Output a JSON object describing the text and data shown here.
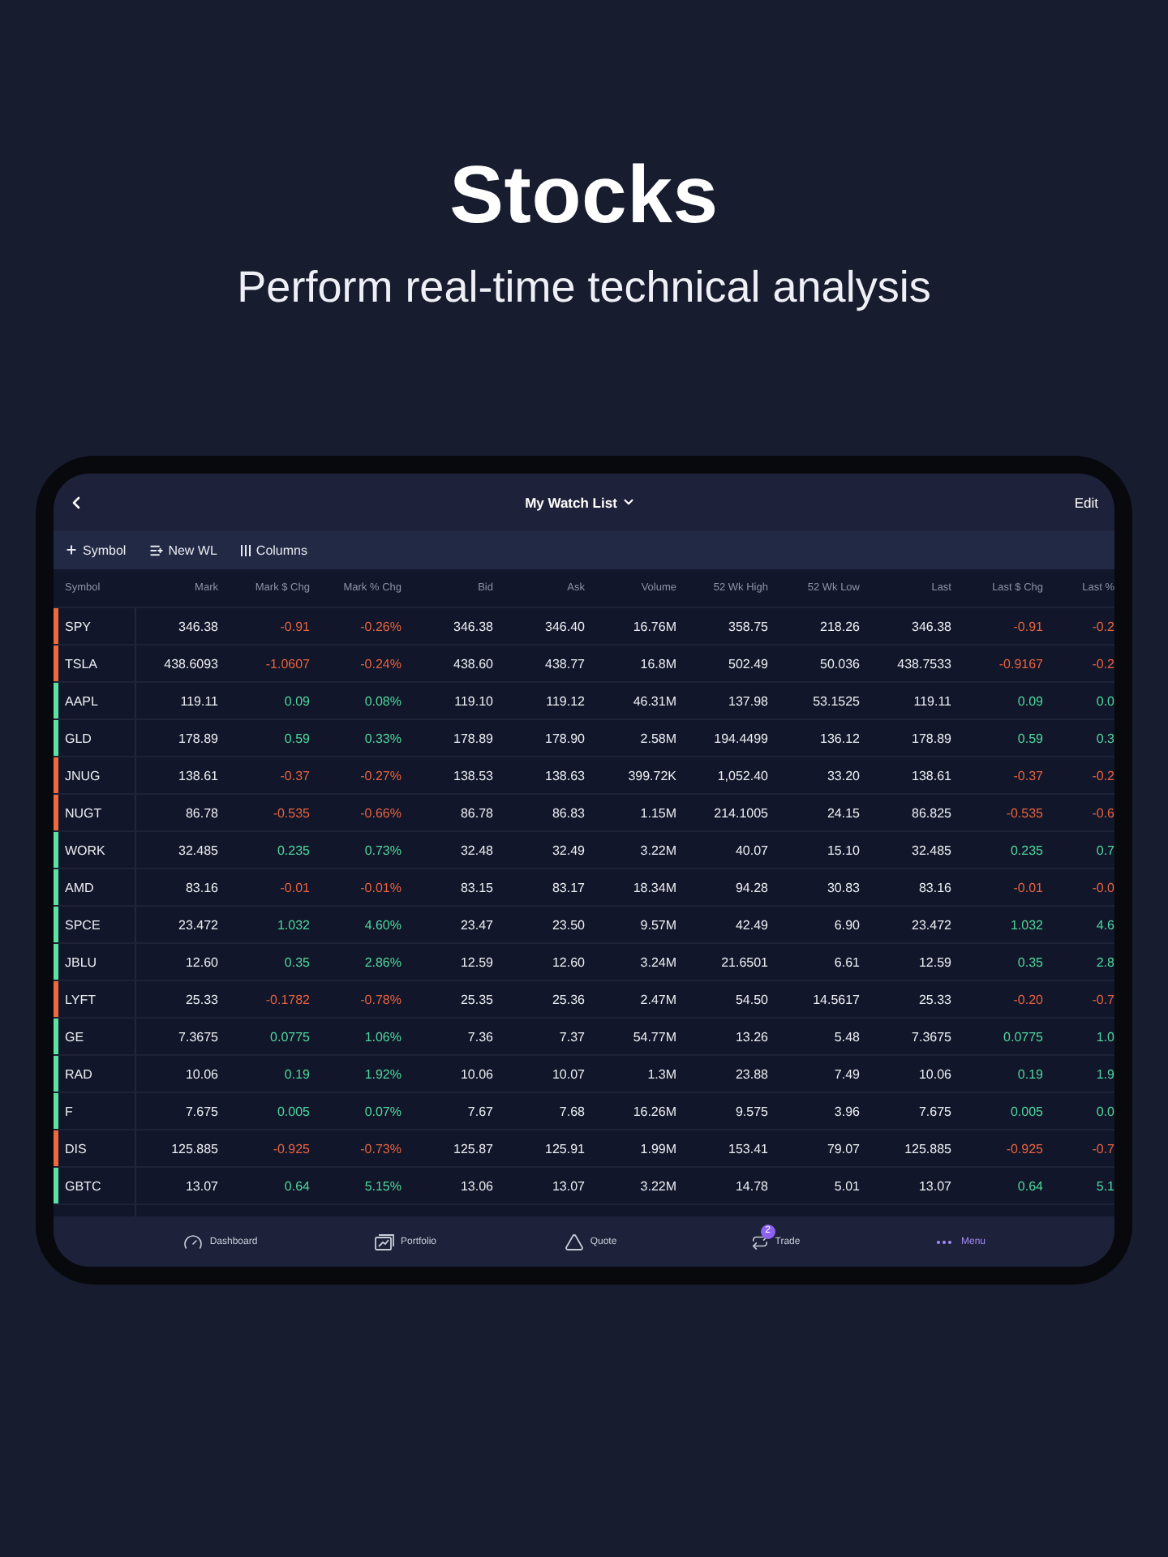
{
  "headline": {
    "title": "Stocks",
    "subtitle": "Perform real-time technical analysis"
  },
  "navbar": {
    "title": "My Watch List",
    "action": "Edit"
  },
  "toolbar": [
    {
      "kind": "add",
      "label": "Symbol"
    },
    {
      "kind": "new-list",
      "label": "New WL"
    },
    {
      "kind": "columns",
      "label": "Columns"
    }
  ],
  "table": {
    "columns": [
      {
        "label": "Symbol",
        "kind": "symbol"
      },
      {
        "label": "Mark",
        "kind": "value"
      },
      {
        "label": "Mark $ Chg",
        "kind": "change"
      },
      {
        "label": "Mark % Chg",
        "kind": "change"
      },
      {
        "label": "Bid",
        "kind": "value"
      },
      {
        "label": "Ask",
        "kind": "value"
      },
      {
        "label": "Volume",
        "kind": "value"
      },
      {
        "label": "52 Wk High",
        "kind": "value"
      },
      {
        "label": "52 Wk Low",
        "kind": "value"
      },
      {
        "label": "Last",
        "kind": "value"
      },
      {
        "label": "Last $ Chg",
        "kind": "change"
      },
      {
        "label": "Last %",
        "kind": "change"
      }
    ],
    "rows": [
      {
        "color": "#ee6a3c",
        "change_values": {
          "color": "#e5623e"
        },
        "cells": [
          "SPY",
          "346.38",
          "-0.91",
          "-0.26%",
          "346.38",
          "346.40",
          "16.76M",
          "358.75",
          "218.26",
          "346.38",
          "-0.91",
          "-0.2"
        ]
      },
      {
        "color": "#ee6a3c",
        "change_values": {
          "color": "#e5623e"
        },
        "cells": [
          "TSLA",
          "438.6093",
          "-1.0607",
          "-0.24%",
          "438.60",
          "438.77",
          "16.8M",
          "502.49",
          "50.036",
          "438.7533",
          "-0.9167",
          "-0.2"
        ]
      },
      {
        "color": "#5be3a4",
        "change_values": {
          "color": "#4fd69c"
        },
        "cells": [
          "AAPL",
          "119.11",
          "0.09",
          "0.08%",
          "119.10",
          "119.12",
          "46.31M",
          "137.98",
          "53.1525",
          "119.11",
          "0.09",
          "0.0"
        ]
      },
      {
        "color": "#5be3a4",
        "change_values": {
          "color": "#4fd69c"
        },
        "cells": [
          "GLD",
          "178.89",
          "0.59",
          "0.33%",
          "178.89",
          "178.90",
          "2.58M",
          "194.4499",
          "136.12",
          "178.89",
          "0.59",
          "0.3"
        ]
      },
      {
        "color": "#ee6a3c",
        "change_values": {
          "color": "#e5623e"
        },
        "cells": [
          "JNUG",
          "138.61",
          "-0.37",
          "-0.27%",
          "138.53",
          "138.63",
          "399.72K",
          "1,052.40",
          "33.20",
          "138.61",
          "-0.37",
          "-0.2"
        ]
      },
      {
        "color": "#ee6a3c",
        "change_values": {
          "color": "#e5623e"
        },
        "cells": [
          "NUGT",
          "86.78",
          "-0.535",
          "-0.66%",
          "86.78",
          "86.83",
          "1.15M",
          "214.1005",
          "24.15",
          "86.825",
          "-0.535",
          "-0.6"
        ]
      },
      {
        "color": "#5be3a4",
        "change_values": {
          "color": "#4fd69c"
        },
        "cells": [
          "WORK",
          "32.485",
          "0.235",
          "0.73%",
          "32.48",
          "32.49",
          "3.22M",
          "40.07",
          "15.10",
          "32.485",
          "0.235",
          "0.7"
        ]
      },
      {
        "color": "#5be3a4",
        "change_values": {
          "color": "#e5623e"
        },
        "cells": [
          "AMD",
          "83.16",
          "-0.01",
          "-0.01%",
          "83.15",
          "83.17",
          "18.34M",
          "94.28",
          "30.83",
          "83.16",
          "-0.01",
          "-0.0"
        ]
      },
      {
        "color": "#5be3a4",
        "change_values": {
          "color": "#4fd69c"
        },
        "cells": [
          "SPCE",
          "23.472",
          "1.032",
          "4.60%",
          "23.47",
          "23.50",
          "9.57M",
          "42.49",
          "6.90",
          "23.472",
          "1.032",
          "4.6"
        ]
      },
      {
        "color": "#5be3a4",
        "change_values": {
          "color": "#4fd69c"
        },
        "cells": [
          "JBLU",
          "12.60",
          "0.35",
          "2.86%",
          "12.59",
          "12.60",
          "3.24M",
          "21.6501",
          "6.61",
          "12.59",
          "0.35",
          "2.8"
        ]
      },
      {
        "color": "#ee6a3c",
        "change_values": {
          "color": "#e5623e"
        },
        "cells": [
          "LYFT",
          "25.33",
          "-0.1782",
          "-0.78%",
          "25.35",
          "25.36",
          "2.47M",
          "54.50",
          "14.5617",
          "25.33",
          "-0.20",
          "-0.7"
        ]
      },
      {
        "color": "#5be3a4",
        "change_values": {
          "color": "#4fd69c"
        },
        "cells": [
          "GE",
          "7.3675",
          "0.0775",
          "1.06%",
          "7.36",
          "7.37",
          "54.77M",
          "13.26",
          "5.48",
          "7.3675",
          "0.0775",
          "1.0"
        ]
      },
      {
        "color": "#5be3a4",
        "change_values": {
          "color": "#4fd69c"
        },
        "cells": [
          "RAD",
          "10.06",
          "0.19",
          "1.92%",
          "10.06",
          "10.07",
          "1.3M",
          "23.88",
          "7.49",
          "10.06",
          "0.19",
          "1.9"
        ]
      },
      {
        "color": "#5be3a4",
        "change_values": {
          "color": "#4fd69c"
        },
        "cells": [
          "F",
          "7.675",
          "0.005",
          "0.07%",
          "7.67",
          "7.68",
          "16.26M",
          "9.575",
          "3.96",
          "7.675",
          "0.005",
          "0.0"
        ]
      },
      {
        "color": "#ee6a3c",
        "change_values": {
          "color": "#e5623e"
        },
        "cells": [
          "DIS",
          "125.885",
          "-0.925",
          "-0.73%",
          "125.87",
          "125.91",
          "1.99M",
          "153.41",
          "79.07",
          "125.885",
          "-0.925",
          "-0.7"
        ]
      },
      {
        "color": "#5be3a4",
        "change_values": {
          "color": "#4fd69c"
        },
        "cells": [
          "GBTC",
          "13.07",
          "0.64",
          "5.15%",
          "13.06",
          "13.07",
          "3.22M",
          "14.78",
          "5.01",
          "13.07",
          "0.64",
          "5.1"
        ]
      }
    ]
  },
  "bottom_nav": [
    {
      "kind": "dashboard",
      "label": "Dashboard",
      "selected": false
    },
    {
      "kind": "portfolio",
      "label": "Portfolio",
      "selected": false
    },
    {
      "kind": "quote",
      "label": "Quote",
      "selected": false
    },
    {
      "kind": "trade",
      "label": "Trade",
      "badge": "2",
      "selected": false
    },
    {
      "kind": "menu",
      "label": "Menu",
      "selected": true
    }
  ]
}
